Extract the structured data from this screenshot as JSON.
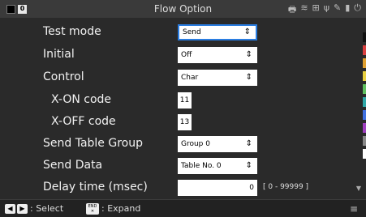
{
  "window": {
    "title": "Flow Option",
    "top_left_badge": "0"
  },
  "status_icons": [
    "printer-icon",
    "wifi-icon",
    "network-icon",
    "usb-icon",
    "wrench-icon",
    "sd-card-icon",
    "power-icon"
  ],
  "fields": {
    "test_mode": {
      "label": "Test mode",
      "value": "Send"
    },
    "initial": {
      "label": "Initial",
      "value": "Off"
    },
    "control": {
      "label": "Control",
      "value": "Char"
    },
    "xon_code": {
      "label": "X-ON code",
      "value": "11"
    },
    "xoff_code": {
      "label": "X-OFF code",
      "value": "13"
    },
    "send_table_group": {
      "label": "Send Table Group",
      "value": "Group 0"
    },
    "send_data": {
      "label": "Send Data",
      "value": "Table No. 0"
    },
    "delay_time": {
      "label": "Delay time (msec)",
      "value": "0",
      "range": "[ 0 - 99999 ]"
    }
  },
  "footer": {
    "select_text": ": Select",
    "end_key_label": "END",
    "end_key_sub": "✕",
    "expand_text": ": Expand"
  },
  "accent_colors": {
    "focus_border": "#2a7de1",
    "right_strip": [
      "#111111",
      "#d94040",
      "#e0a030",
      "#e8d040",
      "#60c060",
      "#30a8a8",
      "#4070e0",
      "#a040c0",
      "#888888",
      "#ffffff"
    ]
  }
}
